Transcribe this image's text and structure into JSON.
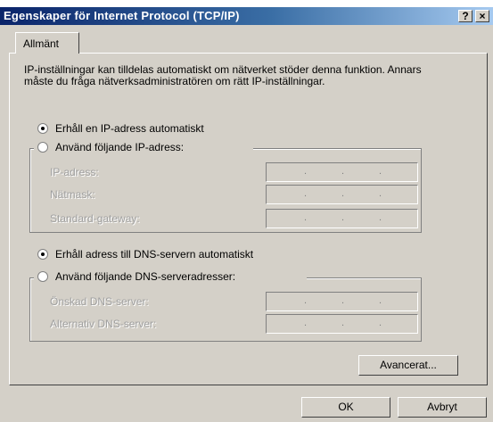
{
  "window": {
    "title": "Egenskaper för Internet Protocol (TCP/IP)",
    "help_label": "?",
    "close_label": "×"
  },
  "tabs": [
    {
      "label": "Allmänt",
      "active": true
    }
  ],
  "info_text": "IP-inställningar kan tilldelas automatiskt om nätverket stöder denna funktion. Annars måste du fråga nätverksadministratören om rätt IP-inställningar.",
  "ip": {
    "auto_label": "Erhåll en IP-adress automatiskt",
    "auto_selected": true,
    "manual_label": "Använd följande IP-adress:",
    "fields": [
      {
        "label": "IP-adress:",
        "value": ""
      },
      {
        "label": "Nätmask:",
        "value": ""
      },
      {
        "label": "Standard-gateway:",
        "value": ""
      }
    ]
  },
  "dns": {
    "auto_label": "Erhåll adress till DNS-servern automatiskt",
    "auto_selected": true,
    "manual_label": "Använd följande DNS-serveradresser:",
    "fields": [
      {
        "label": "Önskad DNS-server:",
        "value": ""
      },
      {
        "label": "Alternativ DNS-server:",
        "value": ""
      }
    ]
  },
  "buttons": {
    "advanced": "Avancerat...",
    "ok": "OK",
    "cancel": "Avbryt"
  }
}
